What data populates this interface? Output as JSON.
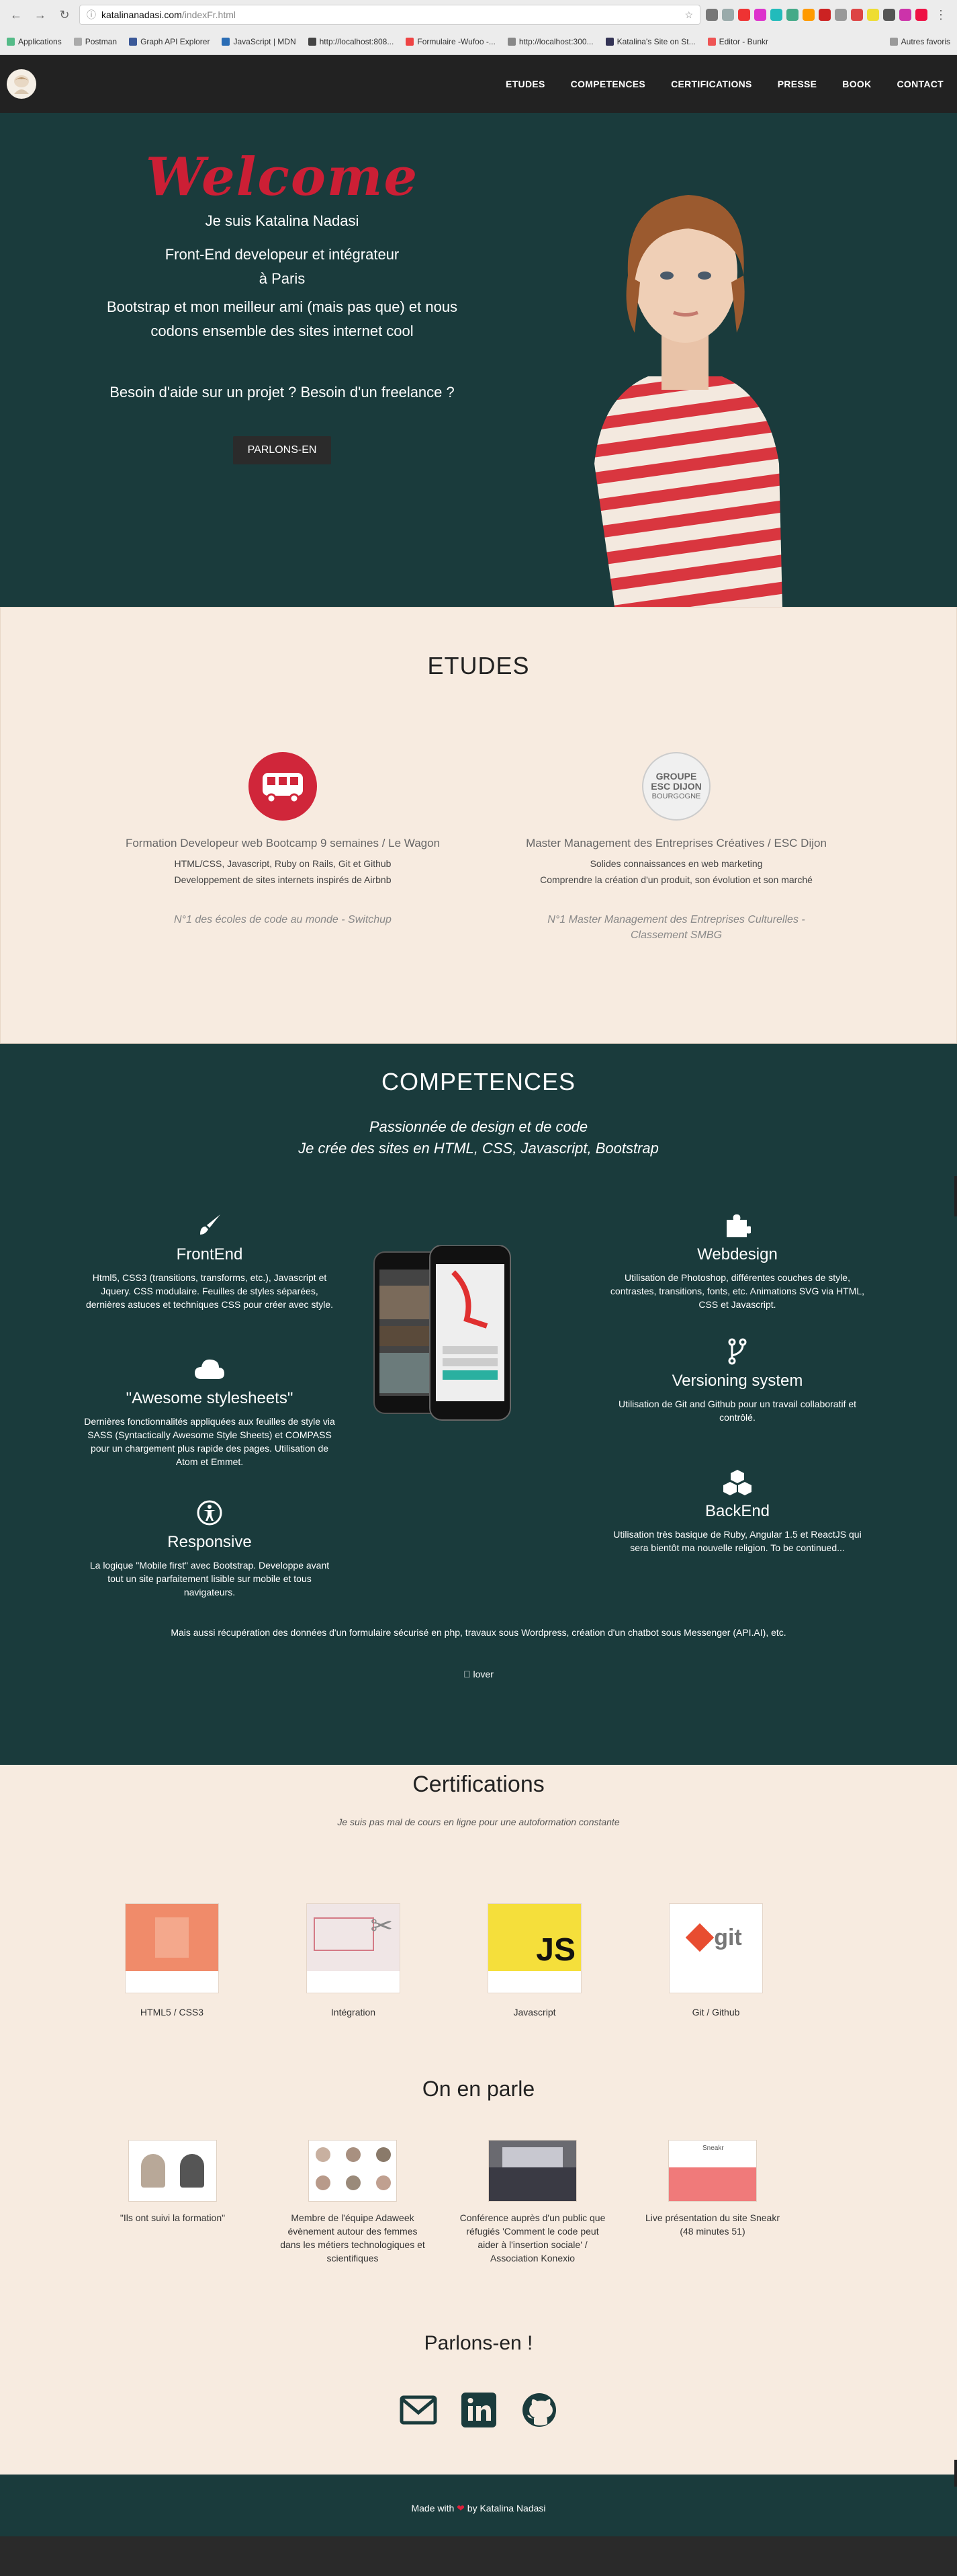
{
  "browser": {
    "url_host": "katalinanadasi.com",
    "url_path": "/indexFr.html",
    "bookmarks": [
      "Applications",
      "Postman",
      "Graph API Explorer",
      "JavaScript | MDN",
      "http://localhost:808...",
      "Formulaire -Wufoo -...",
      "http://localhost:300...",
      "Katalina's Site on St...",
      "Editor - Bunkr"
    ],
    "bookmarks_right": "Autres favoris"
  },
  "nav": {
    "items": [
      "ETUDES",
      "COMPETENCES",
      "CERTIFICATIONS",
      "PRESSE",
      "BOOK",
      "CONTACT"
    ]
  },
  "hero": {
    "welcome": "Welcome",
    "line1": "Je suis Katalina Nadasi",
    "line2": "Front-End developeur et intégrateur",
    "line3": "à Paris",
    "line4": "Bootstrap et mon meilleur ami (mais pas que) et nous",
    "line5": "codons ensemble des sites internet cool",
    "question": "Besoin d'aide sur un projet ? Besoin d'un freelance ?",
    "cta": "PARLONS-EN"
  },
  "etudes": {
    "title": "ETUDES",
    "left": {
      "title": "Formation Developeur web Bootcamp 9 semaines / Le Wagon",
      "lines": [
        "HTML/CSS, Javascript, Ruby on Rails, Git et Github",
        "Developpement de sites internets inspirés de Airbnb"
      ],
      "note": "N°1 des écoles de code au monde - Switchup"
    },
    "right": {
      "badge": [
        "GROUPE",
        "ESC DIJON",
        "BOURGOGNE"
      ],
      "title": "Master Management des Entreprises Créatives / ESC Dijon",
      "lines": [
        "Solides connaissances en web marketing",
        "Comprendre la création d'un produit, son évolution et son marché"
      ],
      "note": "N°1 Master Management des Entreprises Culturelles - Classement SMBG"
    }
  },
  "competences": {
    "title": "COMPETENCES",
    "sub1": "Passionnée de design et de code",
    "sub2": "Je crée des sites en HTML, CSS, Javascript, Bootstrap",
    "skills": [
      {
        "title": "FrontEnd",
        "text": "Html5, CSS3 (transitions, transforms, etc.), Javascript et Jquery. CSS modulaire. Feuilles de styles séparées, dernières astuces et techniques CSS pour créer avec style.",
        "icon": "brush-icon"
      },
      {
        "title": "\"Awesome stylesheets\"",
        "text": "Dernières fonctionnalités appliquées aux feuilles de style via SASS (Syntactically Awesome Style Sheets) et COMPASS pour un chargement plus rapide des pages. Utilisation de Atom et Emmet.",
        "icon": "cloud-icon"
      },
      {
        "title": "Responsive",
        "text": "La logique \"Mobile first\" avec Bootstrap. Developpe avant tout un site parfaitement lisible sur mobile et tous navigateurs.",
        "icon": "accessibility-icon"
      },
      {
        "title": "Webdesign",
        "text": "Utilisation de Photoshop, différentes couches de style, contrastes, transitions, fonts, etc. Animations SVG via HTML, CSS et Javascript.",
        "icon": "puzzle-icon"
      },
      {
        "title": "Versioning system",
        "text": "Utilisation de Git and Github pour un travail collaboratif et contrôlé.",
        "icon": "branch-icon"
      },
      {
        "title": "BackEnd",
        "text": "Utilisation très basique de Ruby, Angular 1.5 et ReactJS qui sera bientôt ma nouvelle religion. To be continued...",
        "icon": "cubes-icon"
      }
    ],
    "footer": "Mais aussi récupération des données d'un formulaire sécurisé en php, travaux sous Wordpress, création d'un chatbot sous Messenger (API.AI), etc.",
    "love": "lover"
  },
  "certifications": {
    "title": "Certifications",
    "sub": "Je suis pas mal de cours en ligne pour une autoformation constante",
    "items": [
      "HTML5 / CSS3",
      "Intégration",
      "Javascript",
      "Git / Github"
    ]
  },
  "press": {
    "title": "On en parle",
    "items": [
      "\"Ils ont suivi la formation\"",
      "Membre de l'équipe Adaweek évènement autour des femmes dans les métiers technologiques et scientifiques",
      "Conférence auprès d'un public que réfugiés 'Comment le code peut aider à l'insertion sociale' / Association Konexio",
      "Live présentation du site Sneakr (48 minutes 51)"
    ]
  },
  "contact": {
    "title": "Parlons-en !"
  },
  "footer": {
    "made": "Made with",
    "by": "by Katalina Nadasi"
  },
  "colors": {
    "dark_teal": "#1a3b3c",
    "cream": "#f7ebe0",
    "accent_red": "#cc1f35"
  }
}
